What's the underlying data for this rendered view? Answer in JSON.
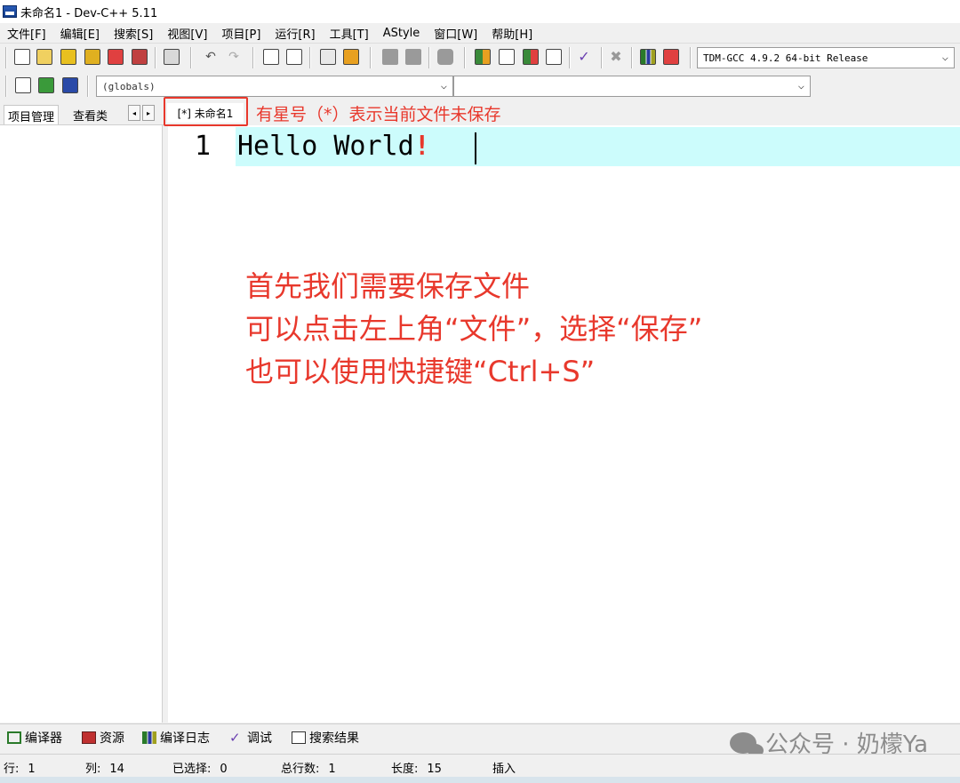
{
  "window": {
    "title": "未命名1 - Dev-C++ 5.11"
  },
  "menu": [
    "文件[F]",
    "编辑[E]",
    "搜索[S]",
    "视图[V]",
    "项目[P]",
    "运行[R]",
    "工具[T]",
    "AStyle",
    "窗口[W]",
    "帮助[H]"
  ],
  "toolbar": {
    "compiler": "TDM-GCC 4.9.2 64-bit Release",
    "scope": "(globals)",
    "function": ""
  },
  "left_tabs": {
    "project": "项目管理",
    "classes": "查看类"
  },
  "editor": {
    "tab_label": "[*] 未命名1",
    "line_number": "1",
    "code": "Hello World",
    "code_highlight": "!"
  },
  "annotations": {
    "top_note": "有星号（*）表示当前文件未保存",
    "line1": "首先我们需要保存文件",
    "line2": "可以点击左上角“文件”，选择“保存”",
    "line3": "也可以使用快捷键“Ctrl+S”"
  },
  "bottom_tabs": [
    "编译器",
    "资源",
    "编译日志",
    "调试",
    "搜索结果"
  ],
  "watermark": "公众号 · 奶檬Ya",
  "status": {
    "row_label": "行:",
    "row": "1",
    "col_label": "列:",
    "col": "14",
    "sel_label": "已选择:",
    "sel": "0",
    "lines_label": "总行数:",
    "lines": "1",
    "len_label": "长度:",
    "len": "15",
    "mode": "插入"
  },
  "colors": {
    "annotation": "#e8382c",
    "active_line": "#ccfcfc"
  }
}
